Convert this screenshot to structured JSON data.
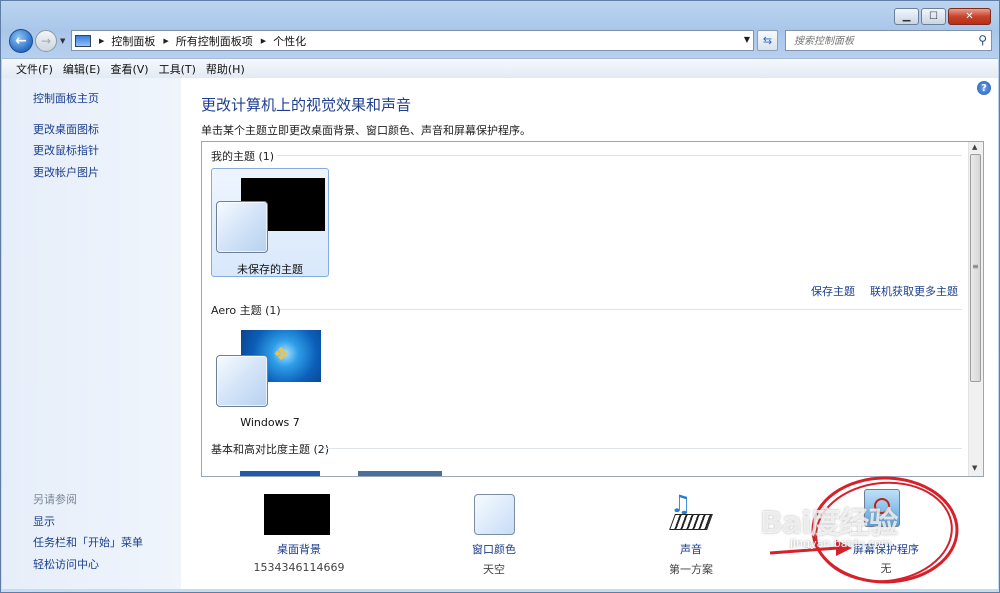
{
  "address": {
    "crumbs": [
      "控制面板",
      "所有控制面板项",
      "个性化"
    ]
  },
  "search": {
    "placeholder": "搜索控制面板"
  },
  "menu": [
    "文件(F)",
    "编辑(E)",
    "查看(V)",
    "工具(T)",
    "帮助(H)"
  ],
  "sidebar": {
    "home": "控制面板主页",
    "links": [
      "更改桌面图标",
      "更改鼠标指针",
      "更改帐户图片"
    ],
    "see_also_heading": "另请参阅",
    "see_also": [
      "显示",
      "任务栏和「开始」菜单",
      "轻松访问中心"
    ]
  },
  "main": {
    "title": "更改计算机上的视觉效果和声音",
    "subtitle": "单击某个主题立即更改桌面背景、窗口颜色、声音和屏幕保护程序。"
  },
  "gallery": {
    "my_themes_heading": "我的主题 (1)",
    "unsaved_theme_label": "未保存的主题",
    "save_theme_link": "保存主题",
    "get_more_link": "联机获取更多主题",
    "aero_heading": "Aero 主题 (1)",
    "windows7_label": "Windows 7",
    "basic_heading": "基本和高对比度主题 (2)"
  },
  "settings": {
    "desktop_background": {
      "label": "桌面背景",
      "value": "1534346114669"
    },
    "window_color": {
      "label": "窗口颜色",
      "value": "天空"
    },
    "sounds": {
      "label": "声音",
      "value": "第一方案"
    },
    "screen_saver": {
      "label": "屏幕保护程序",
      "value": "无"
    }
  },
  "watermark": {
    "text": "Bai度经验",
    "sub": "jingyan.baidu.com"
  },
  "colors": {
    "accent": "#1a3e8c",
    "annotation": "#d8202a"
  }
}
